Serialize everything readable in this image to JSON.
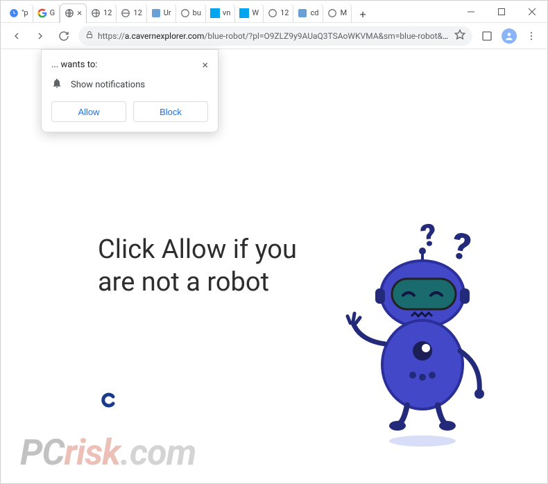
{
  "window": {
    "tabs": [
      "\"p",
      "G",
      "",
      "12",
      "12",
      "Ur",
      "bu",
      "vn",
      "W",
      "12",
      "cd",
      "M"
    ],
    "active_tab_index": 2,
    "newtab_label": "+"
  },
  "toolbar": {
    "url_prefix": "https://",
    "url_host": "a.cavernexplorer.com",
    "url_path": "/blue-robot/?pl=O9ZLZ9y9AUaQ3TSAoWKVMA&sm=blue-robot&click_id..."
  },
  "permission": {
    "title": "... wants to:",
    "request": "Show notifications",
    "allow": "Allow",
    "block": "Block"
  },
  "page": {
    "headline": "Click Allow if you are not a robot"
  },
  "watermark": {
    "pc": "PC",
    "risk": "risk",
    "com": ".com"
  }
}
